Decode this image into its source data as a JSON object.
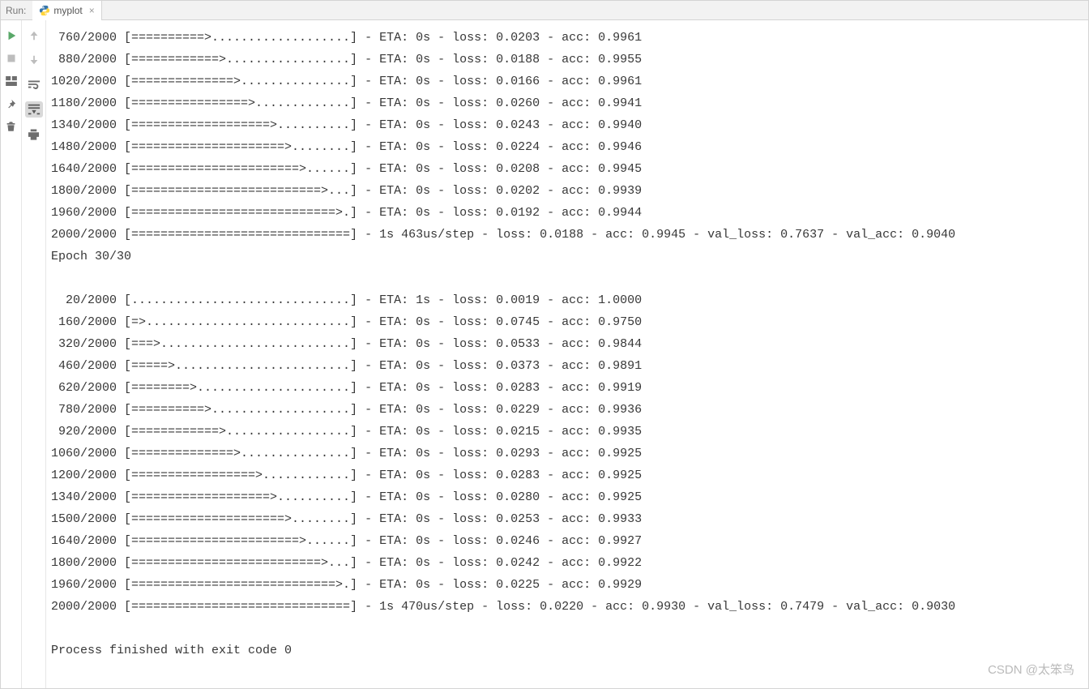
{
  "tabbar": {
    "run_label": "Run:",
    "tab_name": "myplot",
    "close_glyph": "×"
  },
  "watermark": "CSDN @太笨鸟",
  "console_lines": [
    " 760/2000 [==========>...................] - ETA: 0s - loss: 0.0203 - acc: 0.9961",
    " 880/2000 [============>.................] - ETA: 0s - loss: 0.0188 - acc: 0.9955",
    "1020/2000 [==============>...............] - ETA: 0s - loss: 0.0166 - acc: 0.9961",
    "1180/2000 [================>.............] - ETA: 0s - loss: 0.0260 - acc: 0.9941",
    "1340/2000 [===================>..........] - ETA: 0s - loss: 0.0243 - acc: 0.9940",
    "1480/2000 [=====================>........] - ETA: 0s - loss: 0.0224 - acc: 0.9946",
    "1640/2000 [=======================>......] - ETA: 0s - loss: 0.0208 - acc: 0.9945",
    "1800/2000 [==========================>...] - ETA: 0s - loss: 0.0202 - acc: 0.9939",
    "1960/2000 [============================>.] - ETA: 0s - loss: 0.0192 - acc: 0.9944",
    "2000/2000 [==============================] - 1s 463us/step - loss: 0.0188 - acc: 0.9945 - val_loss: 0.7637 - val_acc: 0.9040",
    "Epoch 30/30",
    "",
    "  20/2000 [..............................] - ETA: 1s - loss: 0.0019 - acc: 1.0000",
    " 160/2000 [=>............................] - ETA: 0s - loss: 0.0745 - acc: 0.9750",
    " 320/2000 [===>..........................] - ETA: 0s - loss: 0.0533 - acc: 0.9844",
    " 460/2000 [=====>........................] - ETA: 0s - loss: 0.0373 - acc: 0.9891",
    " 620/2000 [========>.....................] - ETA: 0s - loss: 0.0283 - acc: 0.9919",
    " 780/2000 [==========>...................] - ETA: 0s - loss: 0.0229 - acc: 0.9936",
    " 920/2000 [============>.................] - ETA: 0s - loss: 0.0215 - acc: 0.9935",
    "1060/2000 [==============>...............] - ETA: 0s - loss: 0.0293 - acc: 0.9925",
    "1200/2000 [=================>............] - ETA: 0s - loss: 0.0283 - acc: 0.9925",
    "1340/2000 [===================>..........] - ETA: 0s - loss: 0.0280 - acc: 0.9925",
    "1500/2000 [=====================>........] - ETA: 0s - loss: 0.0253 - acc: 0.9933",
    "1640/2000 [=======================>......] - ETA: 0s - loss: 0.0246 - acc: 0.9927",
    "1800/2000 [==========================>...] - ETA: 0s - loss: 0.0242 - acc: 0.9922",
    "1960/2000 [============================>.] - ETA: 0s - loss: 0.0225 - acc: 0.9929",
    "2000/2000 [==============================] - 1s 470us/step - loss: 0.0220 - acc: 0.9930 - val_loss: 0.7479 - val_acc: 0.9030",
    "",
    "Process finished with exit code 0",
    ""
  ]
}
